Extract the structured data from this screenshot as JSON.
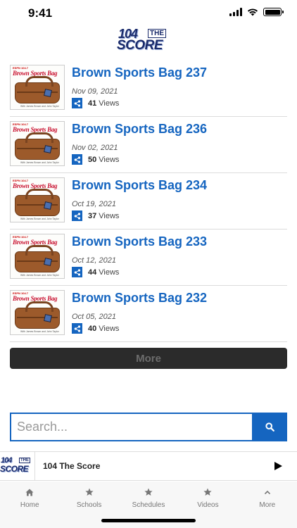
{
  "status_bar": {
    "time": "9:41"
  },
  "header": {
    "logo_number": "104",
    "logo_the": "THE",
    "logo_score": "SCORE"
  },
  "thumbnail": {
    "brand": "ESPN 104.7",
    "title": "Brown Sports Bag",
    "caption": "With James Brown and John Taylor"
  },
  "episodes": [
    {
      "title": "Brown Sports Bag 237",
      "date": "Nov 09, 2021",
      "views": "41",
      "views_label": "Views"
    },
    {
      "title": "Brown Sports Bag 236",
      "date": "Nov 02, 2021",
      "views": "50",
      "views_label": "Views"
    },
    {
      "title": "Brown Sports Bag 234",
      "date": "Oct 19, 2021",
      "views": "37",
      "views_label": "Views"
    },
    {
      "title": "Brown Sports Bag 233",
      "date": "Oct 12, 2021",
      "views": "44",
      "views_label": "Views"
    },
    {
      "title": "Brown Sports Bag 232",
      "date": "Oct 05, 2021",
      "views": "40",
      "views_label": "Views"
    }
  ],
  "more_button": {
    "label": "More"
  },
  "search": {
    "placeholder": "Search..."
  },
  "player": {
    "station": "104 The Score"
  },
  "tabs": [
    {
      "label": "Home",
      "icon": "home-icon"
    },
    {
      "label": "Schools",
      "icon": "star-icon"
    },
    {
      "label": "Schedules",
      "icon": "star-icon"
    },
    {
      "label": "Videos",
      "icon": "star-icon"
    },
    {
      "label": "More",
      "icon": "chevron-up-icon"
    }
  ],
  "colors": {
    "accent": "#1565c0",
    "more_bg": "#2b2b2b",
    "tabbar_bg": "#f7f7f7"
  }
}
